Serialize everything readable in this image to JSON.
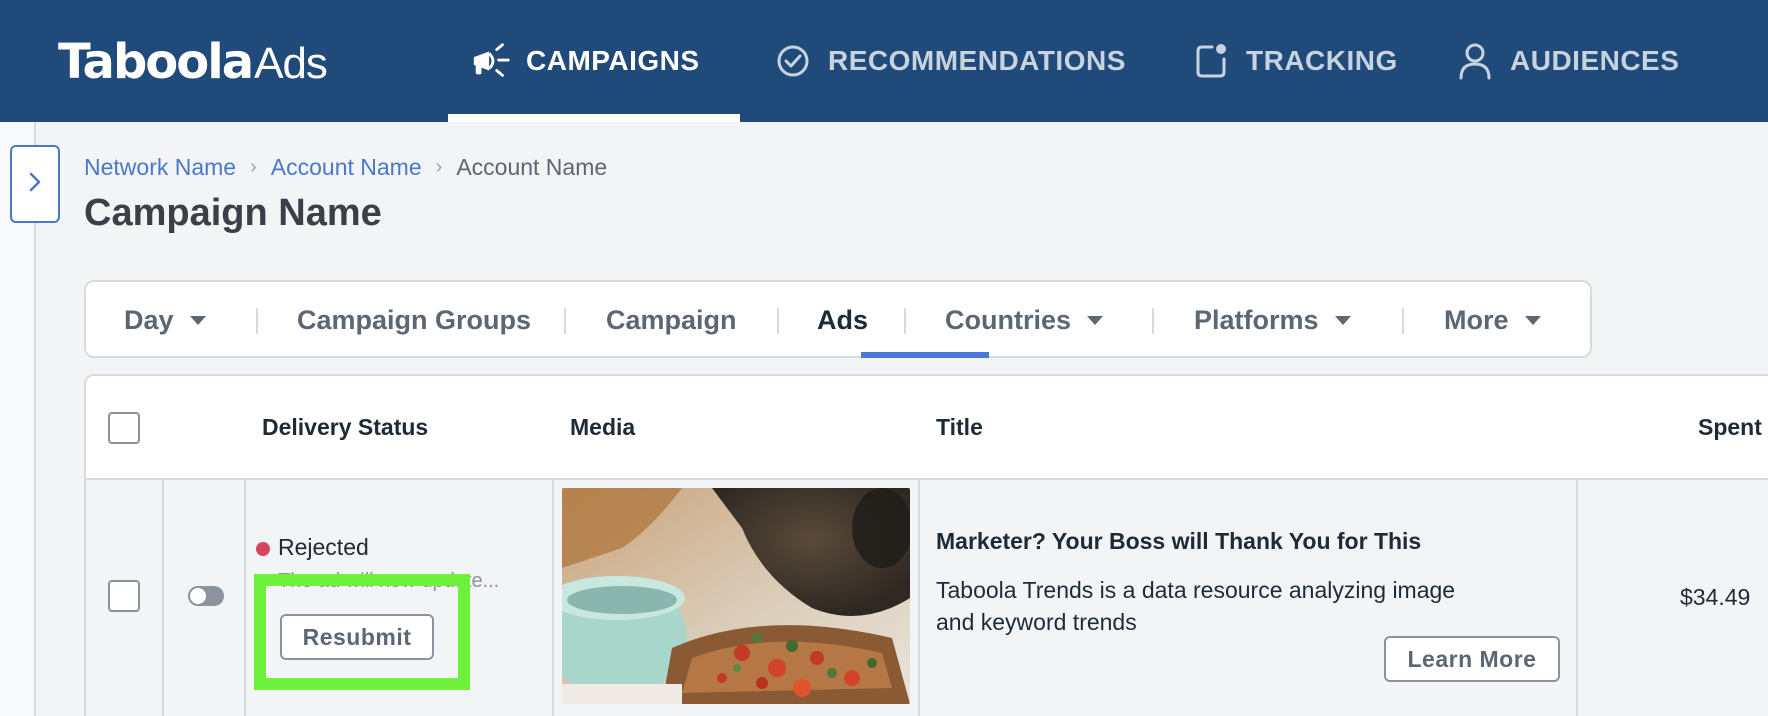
{
  "brand": {
    "logo_main": "Taboola",
    "logo_sub": "Ads"
  },
  "nav": {
    "items": [
      {
        "label": "CAMPAIGNS",
        "icon": "megaphone-icon",
        "active": true
      },
      {
        "label": "RECOMMENDATIONS",
        "icon": "check-circle-icon",
        "active": false
      },
      {
        "label": "TRACKING",
        "icon": "tracking-icon",
        "active": false
      },
      {
        "label": "AUDIENCES",
        "icon": "user-icon",
        "active": false
      }
    ]
  },
  "breadcrumb": {
    "items": [
      "Network Name",
      "Account Name",
      "Account Name"
    ]
  },
  "page": {
    "title": "Campaign Name"
  },
  "tabs": {
    "items": [
      {
        "label": "Day",
        "dropdown": true
      },
      {
        "label": "Campaign Groups",
        "dropdown": false
      },
      {
        "label": "Campaign",
        "dropdown": false
      },
      {
        "label": "Ads",
        "dropdown": false,
        "active": true
      },
      {
        "label": "Countries",
        "dropdown": true
      },
      {
        "label": "Platforms",
        "dropdown": true
      },
      {
        "label": "More",
        "dropdown": true
      }
    ]
  },
  "table": {
    "headers": [
      "Delivery Status",
      "Media",
      "Title",
      "Spent"
    ],
    "row": {
      "status": "Rejected",
      "status_reason": "The ad will now update...",
      "resubmit_label": "Resubmit",
      "ad_title": "Marketer? Your Boss will Thank You for This",
      "ad_description": "Taboola Trends is a data resource analyzing image and keyword trends",
      "cta_label": "Learn More",
      "spent": "$34.49"
    }
  },
  "colors": {
    "nav_bg": "#1f4a7a",
    "link": "#4a78c9",
    "rejected": "#d6455a",
    "highlight": "#6ef03d",
    "tab_active_underline": "#4a78d6"
  }
}
